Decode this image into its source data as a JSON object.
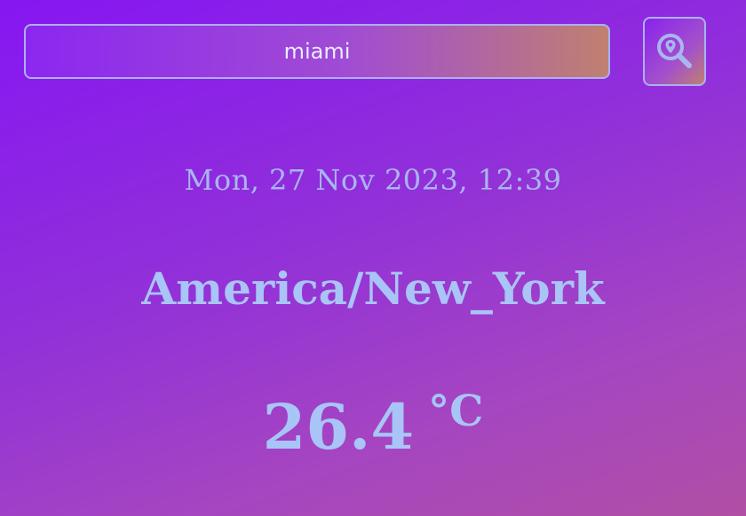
{
  "search": {
    "value": "miami",
    "icon": "location-search-icon"
  },
  "weather": {
    "datetime": "Mon, 27 Nov 2023, 12:39",
    "timezone": "America/New_York",
    "temperature": "26.4",
    "unit": "°C"
  },
  "colors": {
    "accent": "#a9c4f6",
    "border": "#a8b2f0",
    "background_start": "#8616f2",
    "background_end": "#b04fa4"
  }
}
